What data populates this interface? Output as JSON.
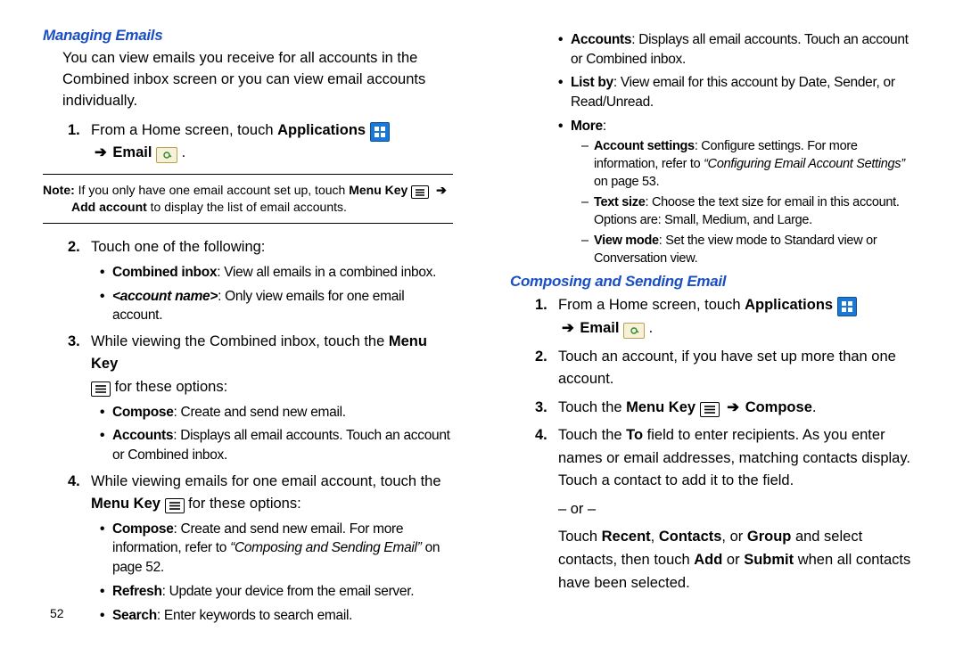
{
  "page_number": "52",
  "left": {
    "heading": "Managing Emails",
    "intro": "You can view emails you receive for all accounts in the Combined inbox screen or you can view email accounts individually.",
    "step1_a": "From a Home screen, touch ",
    "applications": "Applications",
    "arrow": "➔",
    "email": "Email",
    "note_label": "Note:",
    "note_a": " If you only have one email account set up, touch ",
    "note_menu_key": "Menu Key",
    "note_b": "Add account",
    "note_c": " to display the list of email accounts.",
    "step2": "Touch one of the following:",
    "s2_b1_label": "Combined inbox",
    "s2_b1_text": ": View all emails in a combined inbox.",
    "s2_b2_label": "<account name>",
    "s2_b2_text": ": Only view emails for one email account.",
    "step3_a": "While viewing the Combined inbox, touch the ",
    "step3_menu": "Menu Key",
    "step3_b": " for these options:",
    "s3_b1_label": "Compose",
    "s3_b1_text": ": Create and send new email.",
    "s3_b2_label": "Accounts",
    "s3_b2_text": ": Displays all email accounts. Touch an account or Combined inbox.",
    "step4_a": "While viewing emails for one email account, touch the ",
    "step4_menu": "Menu Key",
    "step4_b": "  for these options:",
    "s4_b1_label": "Compose",
    "s4_b1_text_a": ": Create and send new email. For more information, refer to ",
    "s4_b1_ref": "“Composing and Sending Email”",
    "s4_b1_text_b": "  on page 52.",
    "s4_b2_label": "Refresh",
    "s4_b2_text": ": Update your device from the email server.",
    "s4_b3_label": "Search",
    "s4_b3_text": ": Enter keywords to search email."
  },
  "right": {
    "cont_b1_label": "Accounts",
    "cont_b1_text": ": Displays all email accounts. Touch an account or Combined inbox.",
    "cont_b2_label": "List by",
    "cont_b2_text": ": View email for this account by Date, Sender, or Read/Unread.",
    "cont_b3_label": "More",
    "cont_b3_colon": ":",
    "d1_label": "Account settings",
    "d1_text_a": ": Configure settings. For more information, refer to ",
    "d1_ref": "“Configuring Email Account Settings”",
    "d1_text_b": "  on page 53.",
    "d2_label": "Text size",
    "d2_text": ": Choose the text size for email in this account. Options are: Small, Medium, and Large.",
    "d3_label": "View mode",
    "d3_text": ": Set the view mode to Standard view or Conversation view.",
    "heading": "Composing and Sending Email",
    "step1_a": "From a Home screen, touch ",
    "applications": "Applications",
    "arrow": "➔",
    "email": "Email",
    "step2": "Touch an account, if you have set up more than one account.",
    "step3_a": "Touch the ",
    "step3_menu": "Menu Key",
    "step3_comp": "Compose",
    "dot": ".",
    "step4_a": "Touch the ",
    "step4_to": "To",
    "step4_b": " field to enter recipients. As you enter names or email addresses, matching contacts display. Touch a contact to add it to the field.",
    "or": "– or –",
    "step4_c_a": "Touch ",
    "step4_recent": "Recent",
    "step4_c_b": ", ",
    "step4_contacts": "Contacts",
    "step4_c_c": ", or ",
    "step4_group": "Group",
    "step4_c_d": " and select contacts, then touch ",
    "step4_add": "Add",
    "step4_c_e": " or ",
    "step4_submit": "Submit",
    "step4_c_f": " when all contacts have been selected."
  }
}
